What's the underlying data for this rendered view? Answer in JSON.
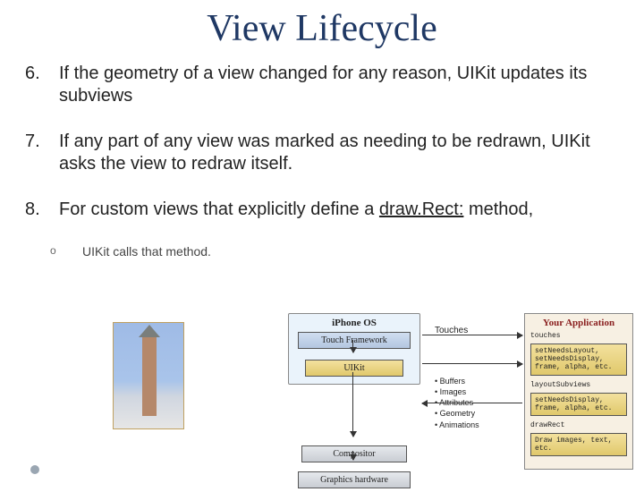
{
  "title": "View Lifecycle",
  "items": [
    {
      "num": "6.",
      "text": "If the geometry of a view changed for any reason, UIKit updates its subviews"
    },
    {
      "num": "7.",
      "text": "If any part of any view was marked as needing to be redrawn, UIKit asks the view to redraw itself."
    },
    {
      "num": "8.",
      "text_a": "For custom views that explicitly define a ",
      "link": "draw.Rect:",
      "text_b": " method,"
    }
  ],
  "sub": {
    "bullet": "o",
    "text": "UIKit calls that method."
  },
  "diagram": {
    "os_title": "iPhone OS",
    "touch": "Touch Framework",
    "uikit": "UIKit",
    "compositor": "Compositor",
    "hardware": "Graphics hardware",
    "touches_label": "Touches",
    "bullets": [
      "Buffers",
      "Images",
      "Attributes",
      "Geometry",
      "Animations"
    ],
    "app_title": "Your Application",
    "app_touches": "touches",
    "app_box1": "setNeedsLayout,\nsetNeedsDisplay,\nframe, alpha, etc.",
    "app_layout": "layoutSubviews",
    "app_box2": "setNeedsDisplay,\nframe, alpha, etc.",
    "app_drawrect": "drawRect",
    "app_draw": "Draw images, text, etc."
  }
}
